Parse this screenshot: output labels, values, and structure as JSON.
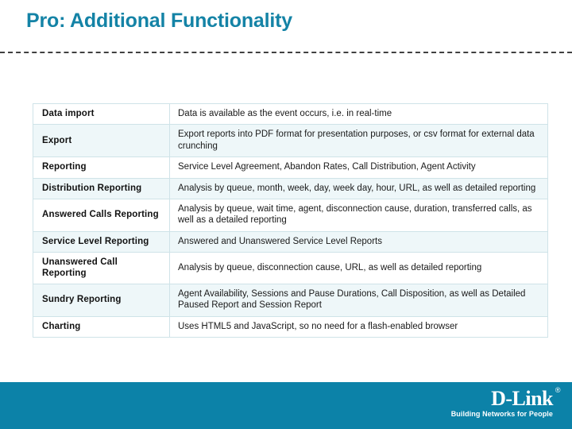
{
  "slide": {
    "title": "Pro: Additional Functionality",
    "title_color": "#1483a6",
    "divider_color": "#404040",
    "background": "#ffffff"
  },
  "table": {
    "border_color": "#cfe3e8",
    "tint_color": "#eef7f9",
    "rows": [
      {
        "feature": "Data import",
        "description": "Data is available as the event occurs, i.e. in real-time"
      },
      {
        "feature": "Export",
        "description": "Export reports into PDF format for presentation purposes, or csv format for external data crunching"
      },
      {
        "feature": "Reporting",
        "description": "Service Level Agreement, Abandon Rates, Call Distribution, Agent Activity"
      },
      {
        "feature": "Distribution Reporting",
        "description": "Analysis by queue, month, week, day, week day, hour, URL, as well as detailed reporting"
      },
      {
        "feature": "Answered Calls Reporting",
        "description": "Analysis by queue, wait time, agent, disconnection cause, duration, transferred calls, as well as a detailed reporting"
      },
      {
        "feature": "Service Level Reporting",
        "description": "Answered and Unanswered Service Level Reports"
      },
      {
        "feature": "Unanswered Call Reporting",
        "description": "Analysis by queue, disconnection cause, URL, as well as detailed reporting"
      },
      {
        "feature": "Sundry Reporting",
        "description": "Agent Availability, Sessions and Pause Durations, Call Disposition, as well as Detailed Paused Report and Session Report"
      },
      {
        "feature": "Charting",
        "description": "Uses HTML5 and JavaScript, so no need for a flash-enabled browser"
      }
    ]
  },
  "footer": {
    "background": "#0c82a8",
    "logo_text": "D-Link",
    "logo_registered": "®",
    "tagline": "Building Networks for People"
  }
}
